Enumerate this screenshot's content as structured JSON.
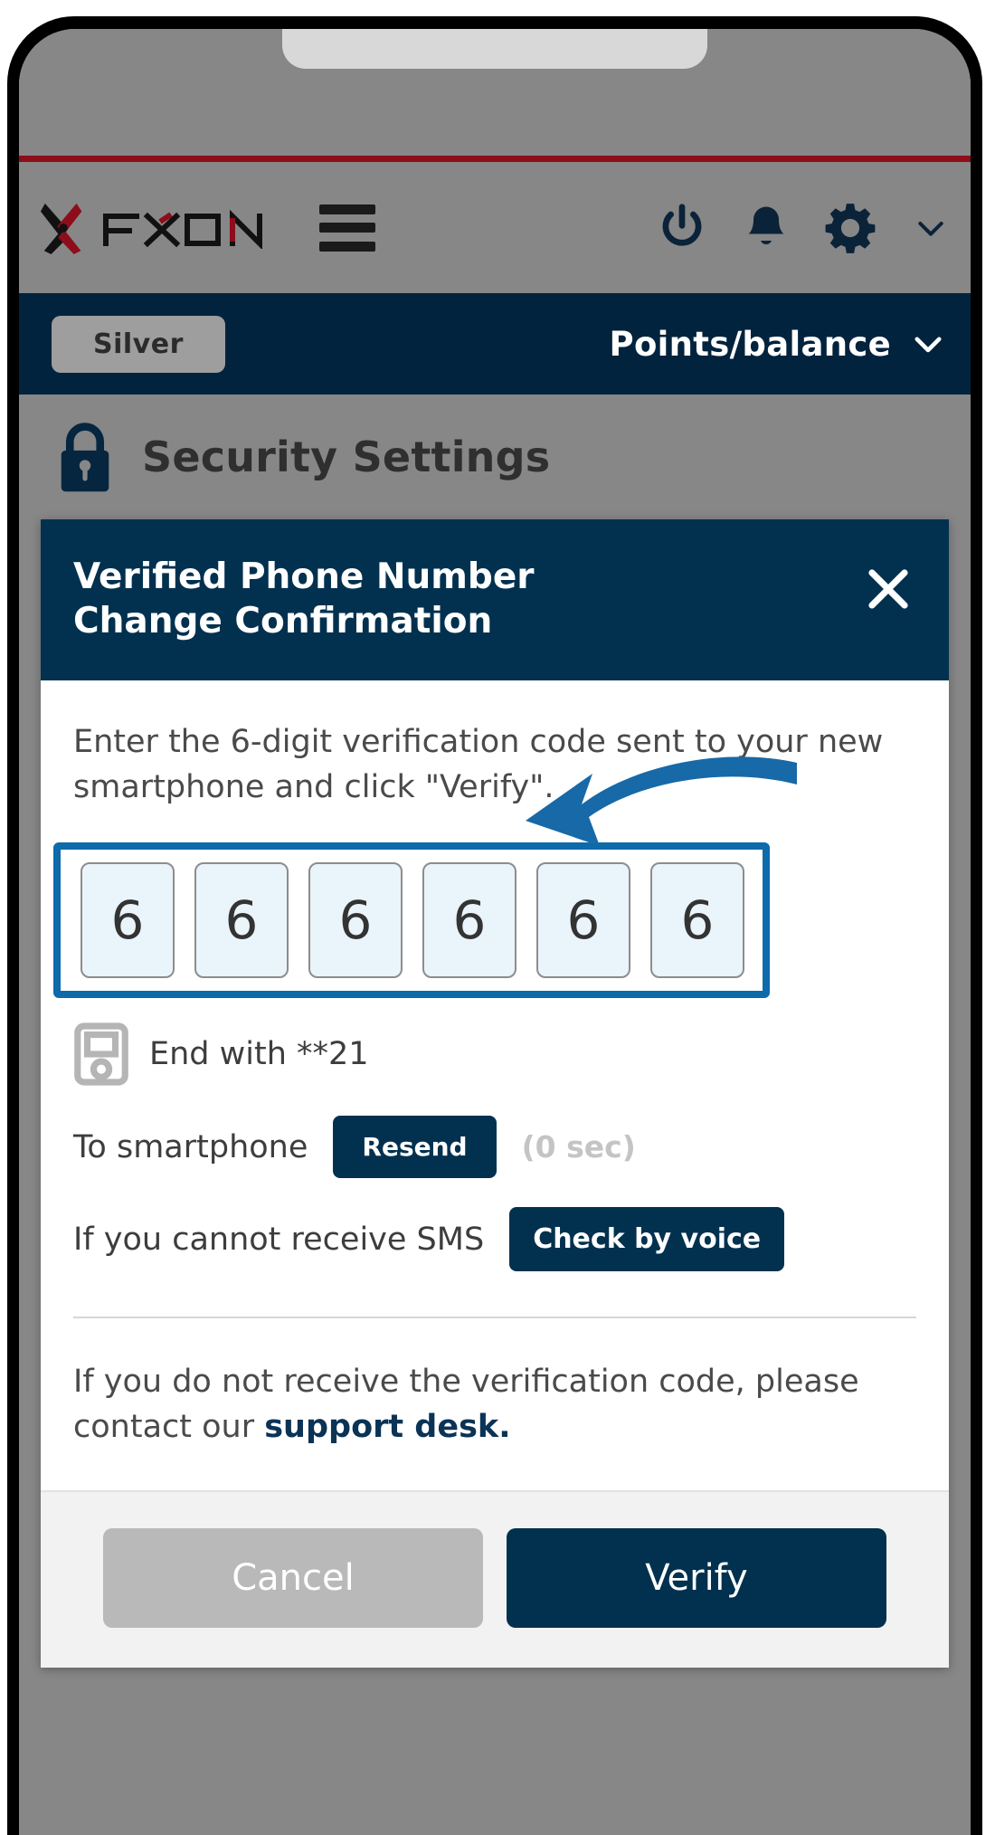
{
  "brand": {
    "name": "FXON",
    "logo_icon": "fxon-x-logo-icon",
    "menu_icon": "hamburger-menu-icon"
  },
  "header": {
    "icons": [
      {
        "name": "power-icon",
        "label": "Power"
      },
      {
        "name": "bell-icon",
        "label": "Notifications"
      },
      {
        "name": "gear-icon",
        "label": "Settings"
      },
      {
        "name": "chevron-down-icon",
        "label": "More"
      }
    ]
  },
  "subbar": {
    "rank_badge": "Silver",
    "points_label": "Points/balance",
    "points_chevron_icon": "chevron-down-icon"
  },
  "page": {
    "lock_icon": "lock-icon",
    "title": "Security Settings"
  },
  "modal": {
    "title": "Verified Phone Number Change Confirmation",
    "close_icon": "close-icon",
    "instruction": "Enter the 6-digit verification code sent to your new smartphone and click \"Verify\".",
    "otp": {
      "digits": [
        "6",
        "6",
        "6",
        "6",
        "6",
        "6"
      ],
      "highlight_color": "#0d6aab",
      "box_fill": "#eaf4fb",
      "arrow_icon": "pointer-arrow-icon"
    },
    "masked_number": {
      "device_icon": "mobile-device-icon",
      "text": "End with **21"
    },
    "resend_row": {
      "label": "To smartphone",
      "button": "Resend",
      "timer": "(0 sec)"
    },
    "voice_row": {
      "label": "If you cannot receive SMS",
      "button": "Check by voice"
    },
    "note": {
      "lead": "If you do not receive the verification code, please contact our ",
      "emphasis": "support desk."
    },
    "footer": {
      "cancel_label": "Cancel",
      "verify_label": "Verify"
    }
  },
  "colors": {
    "brand_red": "#8d0d1b",
    "navy": "#02314f",
    "navy_dark": "#02233d",
    "accent_blue": "#0d6aab",
    "screen_gray": "#878787"
  }
}
